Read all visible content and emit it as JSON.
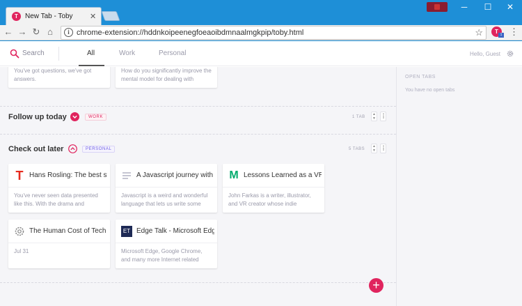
{
  "browser": {
    "tab_title": "New Tab - Toby",
    "tab_favicon": "T",
    "url": "chrome-extension://hddnkoipeenegfoeaoibdmnaalmgkpip/toby.html",
    "extension_letter": "T",
    "extension_badge": "1"
  },
  "header": {
    "search_label": "Search",
    "tabs": [
      {
        "label": "All",
        "active": true
      },
      {
        "label": "Work",
        "active": false
      },
      {
        "label": "Personal",
        "active": false
      }
    ],
    "greeting": "Hello, Guest"
  },
  "sidebar": {
    "title": "OPEN TABS",
    "empty_text": "You have no open tabs"
  },
  "partial_cards": [
    {
      "desc": "You've got questions, we've got answers."
    },
    {
      "desc": "How do you significantly improve the mental model for dealing with"
    }
  ],
  "collections": [
    {
      "title": "Follow up today",
      "tag": "WORK",
      "tab_count": "1 TAB",
      "tag_color": "#e0245e"
    },
    {
      "title": "Check out later",
      "tag": "PERSONAL",
      "tab_count": "5 TABS",
      "tag_color": "#6c5ce7",
      "cards": [
        {
          "icon": "T",
          "title": "Hans Rosling: The best stats",
          "desc": "You've never seen data presented like this. With the drama and"
        },
        {
          "icon": "doc-icon",
          "title": "A Javascript journey with",
          "desc": "Javascript is a weird and wonderful language that lets us write some"
        },
        {
          "icon": "M",
          "title": "Lessons Learned as a VR",
          "desc": "John Farkas is a writer, illustrator, and VR creator whose indie"
        },
        {
          "icon": "gear-icon",
          "title": "The Human Cost of Tech",
          "desc": "Jul 31"
        },
        {
          "icon": "ET",
          "title": "Edge Talk - Microsoft Edge",
          "desc": "Microsoft Edge, Google Chrome, and many more Internet related"
        }
      ]
    }
  ],
  "colors": {
    "accent": "#e0245e",
    "personal": "#6c5ce7",
    "chrome_blue": "#1e8fd7"
  }
}
